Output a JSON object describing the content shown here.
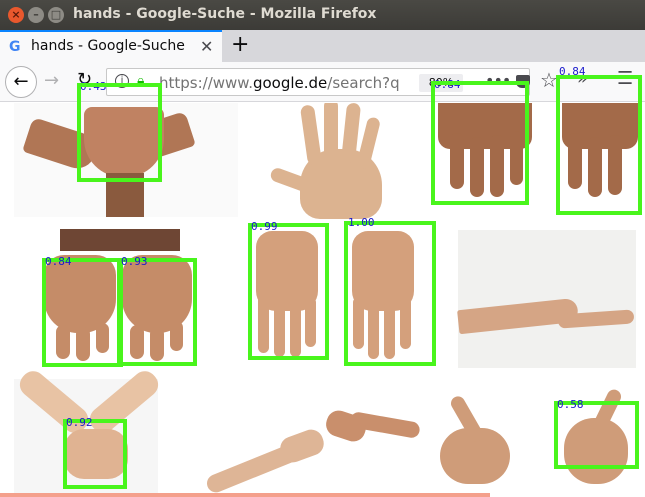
{
  "window": {
    "title": "hands - Google-Suche - Mozilla Firefox"
  },
  "tab": {
    "label": "hands - Google-Suche",
    "favicon": "G"
  },
  "urlbar": {
    "url_prefix": "https://www.",
    "url_domain": "google.de",
    "url_suffix": "/search?q",
    "zoom": "80%"
  },
  "detections": [
    {
      "score": "0.43"
    },
    {
      "score": "0.84"
    },
    {
      "score": "0.84"
    },
    {
      "score": "0.84"
    },
    {
      "score": "0.93"
    },
    {
      "score": "0.99"
    },
    {
      "score": "1.00"
    },
    {
      "score": "0.92"
    },
    {
      "score": "0.58"
    }
  ],
  "colors": {
    "detection_box": "#49f51c",
    "score_text": "#1a1acc",
    "tab_accent": "#0a84ff"
  },
  "icons": [
    "close-icon",
    "minimize-icon",
    "maximize-icon",
    "back-icon",
    "forward-icon",
    "reload-icon",
    "info-icon",
    "lock-icon",
    "more-icon",
    "pocket-icon",
    "star-icon",
    "overflow-icon",
    "menu-icon",
    "new-tab-icon"
  ]
}
